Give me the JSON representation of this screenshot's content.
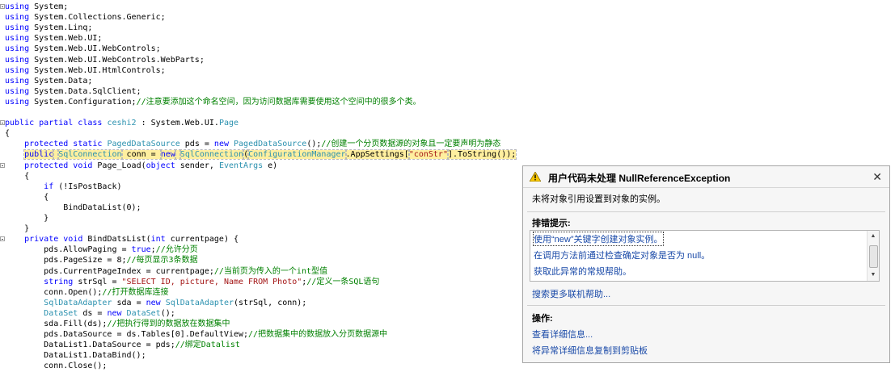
{
  "code_lines": [
    {
      "segments": [
        {
          "t": "using",
          "c": "kw"
        },
        {
          "t": " System;"
        }
      ]
    },
    {
      "segments": [
        {
          "t": "using",
          "c": "kw"
        },
        {
          "t": " System.Collections.Generic;"
        }
      ]
    },
    {
      "segments": [
        {
          "t": "using",
          "c": "kw"
        },
        {
          "t": " System.Linq;"
        }
      ]
    },
    {
      "segments": [
        {
          "t": "using",
          "c": "kw"
        },
        {
          "t": " System.Web.UI;"
        }
      ]
    },
    {
      "segments": [
        {
          "t": "using",
          "c": "kw"
        },
        {
          "t": " System.Web.UI.WebControls;"
        }
      ]
    },
    {
      "segments": [
        {
          "t": "using",
          "c": "kw"
        },
        {
          "t": " System.Web.UI.WebControls.WebParts;"
        }
      ]
    },
    {
      "segments": [
        {
          "t": "using",
          "c": "kw"
        },
        {
          "t": " System.Web.UI.HtmlControls;"
        }
      ]
    },
    {
      "segments": [
        {
          "t": "using",
          "c": "kw"
        },
        {
          "t": " System.Data;"
        }
      ]
    },
    {
      "segments": [
        {
          "t": "using",
          "c": "kw"
        },
        {
          "t": " System.Data.SqlClient;"
        }
      ]
    },
    {
      "segments": [
        {
          "t": "using",
          "c": "kw"
        },
        {
          "t": " System.Configuration;"
        },
        {
          "t": "//注意要添加这个命名空间，因为访问数据库需要使用这个空间中的很多个类。",
          "c": "cm"
        }
      ]
    },
    {
      "segments": []
    },
    {
      "segments": [
        {
          "t": "public partial class",
          "c": "kw"
        },
        {
          "t": " "
        },
        {
          "t": "ceshi2",
          "c": "ty"
        },
        {
          "t": " : System.Web.UI."
        },
        {
          "t": "Page",
          "c": "ty"
        }
      ]
    },
    {
      "segments": [
        {
          "t": "{"
        }
      ]
    },
    {
      "segments": [
        {
          "t": "    "
        },
        {
          "t": "protected static",
          "c": "kw"
        },
        {
          "t": " "
        },
        {
          "t": "PagedDataSource",
          "c": "ty"
        },
        {
          "t": " pds = "
        },
        {
          "t": "new",
          "c": "kw"
        },
        {
          "t": " "
        },
        {
          "t": "PagedDataSource",
          "c": "ty"
        },
        {
          "t": "();"
        },
        {
          "t": "//创建一个分页数据源的对象且一定要声明为静态",
          "c": "cm"
        }
      ]
    },
    {
      "segments": [
        {
          "t": "    "
        },
        {
          "t": "public",
          "c": "kw",
          "h": 1
        },
        {
          "t": " ",
          "h": 1
        },
        {
          "t": "SqlConnection",
          "c": "ty",
          "h": 1
        },
        {
          "t": " conn = ",
          "h": 1
        },
        {
          "t": "new",
          "c": "kw",
          "h": 1
        },
        {
          "t": " ",
          "h": 1
        },
        {
          "t": "SqlConnection",
          "c": "ty",
          "h": 1
        },
        {
          "t": "(",
          "h": 1
        },
        {
          "t": "ConfigurationManager",
          "c": "ty",
          "h": 1
        },
        {
          "t": ".AppSettings[",
          "h": 1
        },
        {
          "t": "\"conStr\"",
          "c": "st",
          "h": 1
        },
        {
          "t": "].ToString());",
          "h": 1
        }
      ]
    },
    {
      "segments": [
        {
          "t": "    "
        },
        {
          "t": "protected void",
          "c": "kw"
        },
        {
          "t": " Page_Load("
        },
        {
          "t": "object",
          "c": "kw"
        },
        {
          "t": " sender, "
        },
        {
          "t": "EventArgs",
          "c": "ty"
        },
        {
          "t": " e)"
        }
      ]
    },
    {
      "segments": [
        {
          "t": "    {"
        }
      ]
    },
    {
      "segments": [
        {
          "t": "        "
        },
        {
          "t": "if",
          "c": "kw"
        },
        {
          "t": " (!IsPostBack)"
        }
      ]
    },
    {
      "segments": [
        {
          "t": "        {"
        }
      ]
    },
    {
      "segments": [
        {
          "t": "            BindDataList(0);"
        }
      ]
    },
    {
      "segments": [
        {
          "t": "        }"
        }
      ]
    },
    {
      "segments": [
        {
          "t": "    }"
        }
      ]
    },
    {
      "segments": [
        {
          "t": "    "
        },
        {
          "t": "private void",
          "c": "kw"
        },
        {
          "t": " BindDatsList("
        },
        {
          "t": "int",
          "c": "kw"
        },
        {
          "t": " currentpage) {"
        }
      ]
    },
    {
      "segments": [
        {
          "t": "        pds.AllowPaging = "
        },
        {
          "t": "true",
          "c": "kw"
        },
        {
          "t": ";"
        },
        {
          "t": "//允许分页",
          "c": "cm"
        }
      ]
    },
    {
      "segments": [
        {
          "t": "        pds.PageSize = 8;"
        },
        {
          "t": "//每页显示3条数据",
          "c": "cm"
        }
      ]
    },
    {
      "segments": [
        {
          "t": "        pds.CurrentPageIndex = currentpage;"
        },
        {
          "t": "//当前页为传入的一个int型值",
          "c": "cm"
        }
      ]
    },
    {
      "segments": [
        {
          "t": "        "
        },
        {
          "t": "string",
          "c": "kw"
        },
        {
          "t": " strSql = "
        },
        {
          "t": "\"SELECT ID, picture, Name FROM Photo\"",
          "c": "st"
        },
        {
          "t": ";"
        },
        {
          "t": "//定义一条SQL语句",
          "c": "cm"
        }
      ]
    },
    {
      "segments": [
        {
          "t": "        conn.Open();"
        },
        {
          "t": "//打开数据库连接",
          "c": "cm"
        }
      ]
    },
    {
      "segments": [
        {
          "t": "        "
        },
        {
          "t": "SqlDataAdapter",
          "c": "ty"
        },
        {
          "t": " sda = "
        },
        {
          "t": "new",
          "c": "kw"
        },
        {
          "t": " "
        },
        {
          "t": "SqlDataAdapter",
          "c": "ty"
        },
        {
          "t": "(strSql, conn);"
        }
      ]
    },
    {
      "segments": [
        {
          "t": "        "
        },
        {
          "t": "DataSet",
          "c": "ty"
        },
        {
          "t": " ds = "
        },
        {
          "t": "new",
          "c": "kw"
        },
        {
          "t": " "
        },
        {
          "t": "DataSet",
          "c": "ty"
        },
        {
          "t": "();"
        }
      ]
    },
    {
      "segments": [
        {
          "t": "        sda.Fill(ds);"
        },
        {
          "t": "//把执行得到的数据放在数据集中",
          "c": "cm"
        }
      ]
    },
    {
      "segments": [
        {
          "t": "        pds.DataSource = ds.Tables[0].DefaultView;"
        },
        {
          "t": "//把数据集中的数据放入分页数据源中",
          "c": "cm"
        }
      ]
    },
    {
      "segments": [
        {
          "t": "        DataList1.DataSource = pds;"
        },
        {
          "t": "//绑定Datalist",
          "c": "cm"
        }
      ]
    },
    {
      "segments": [
        {
          "t": "        DataList1.DataBind();"
        }
      ]
    },
    {
      "segments": [
        {
          "t": "        conn.Close();"
        }
      ]
    }
  ],
  "popup": {
    "title": "用户代码未处理 NullReferenceException",
    "message": "未将对象引用设置到对象的实例。",
    "tips_header": "排错提示:",
    "tips": [
      "使用“new”关键字创建对象实例。",
      "在调用方法前通过检查确定对象是否为 null。",
      "获取此异常的常规帮助。"
    ],
    "search_online": "搜索更多联机帮助...",
    "actions_header": "操作:",
    "view_details": "查看详细信息...",
    "copy_details": "将异常详细信息复制到剪贴板",
    "close_glyph": "✕"
  },
  "colors": {
    "keyword": "#0000ff",
    "type": "#2b91af",
    "comment": "#008000",
    "string": "#a31515",
    "highlight": "#ffef9f"
  }
}
